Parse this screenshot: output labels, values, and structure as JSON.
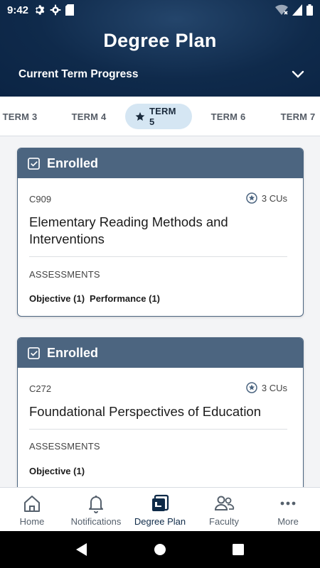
{
  "status_bar": {
    "time": "9:42"
  },
  "header": {
    "title": "Degree Plan",
    "progress_label": "Current Term Progress"
  },
  "term_tabs": [
    {
      "label": "TERM 3",
      "active": false
    },
    {
      "label": "TERM 4",
      "active": false
    },
    {
      "label": "TERM 5",
      "active": true
    },
    {
      "label": "TERM 6",
      "active": false
    },
    {
      "label": "TERM 7",
      "active": false
    }
  ],
  "courses": [
    {
      "status": "Enrolled",
      "code": "C909",
      "cus": "3 CUs",
      "title": "Elementary Reading Methods and Interventions",
      "assessments_label": "ASSESSMENTS",
      "assessments": [
        "Objective (1)",
        "Performance (1)"
      ]
    },
    {
      "status": "Enrolled",
      "code": "C272",
      "cus": "3 CUs",
      "title": "Foundational Perspectives of Education",
      "assessments_label": "ASSESSMENTS",
      "assessments": [
        "Objective (1)"
      ]
    }
  ],
  "bottom_nav": [
    {
      "label": "Home",
      "icon": "home-icon",
      "active": false
    },
    {
      "label": "Notifications",
      "icon": "bell-icon",
      "active": false
    },
    {
      "label": "Degree Plan",
      "icon": "degree-plan-icon",
      "active": true
    },
    {
      "label": "Faculty",
      "icon": "faculty-icon",
      "active": false
    },
    {
      "label": "More",
      "icon": "more-icon",
      "active": false
    }
  ],
  "colors": {
    "header_bg": "#0f2a4b",
    "card_header": "#4c6580",
    "active_tab_bg": "#d5e6f3"
  }
}
